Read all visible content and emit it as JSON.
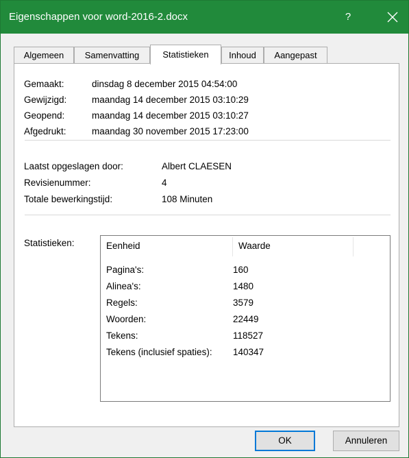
{
  "window": {
    "title": "Eigenschappen voor word-2016-2.docx",
    "help_label": "?",
    "accent_color": "#218a3b"
  },
  "tabs": [
    {
      "label": "Algemeen"
    },
    {
      "label": "Samenvatting"
    },
    {
      "label": "Statistieken"
    },
    {
      "label": "Inhoud"
    },
    {
      "label": "Aangepast"
    }
  ],
  "active_tab": "Statistieken",
  "dates": [
    {
      "label": "Gemaakt:",
      "value": "dinsdag 8 december 2015 04:54:00"
    },
    {
      "label": "Gewijzigd:",
      "value": "maandag 14 december 2015 03:10:29"
    },
    {
      "label": "Geopend:",
      "value": "maandag 14 december 2015 03:10:27"
    },
    {
      "label": "Afgedrukt:",
      "value": "maandag 30 november 2015 17:23:00"
    }
  ],
  "info": [
    {
      "label": "Laatst opgeslagen door:",
      "value": "Albert CLAESEN"
    },
    {
      "label": "Revisienummer:",
      "value": "4"
    },
    {
      "label": "Totale bewerkingstijd:",
      "value": "108 Minuten"
    }
  ],
  "statistics": {
    "label": "Statistieken:",
    "columns": [
      "Eenheid",
      "Waarde"
    ],
    "rows": [
      {
        "unit": "Pagina's:",
        "value": "160"
      },
      {
        "unit": "Alinea's:",
        "value": "1480"
      },
      {
        "unit": "Regels:",
        "value": "3579"
      },
      {
        "unit": "Woorden:",
        "value": "22449"
      },
      {
        "unit": "Tekens:",
        "value": "118527"
      },
      {
        "unit": "Tekens (inclusief spaties):",
        "value": "140347"
      }
    ]
  },
  "buttons": {
    "ok": "OK",
    "cancel": "Annuleren"
  }
}
